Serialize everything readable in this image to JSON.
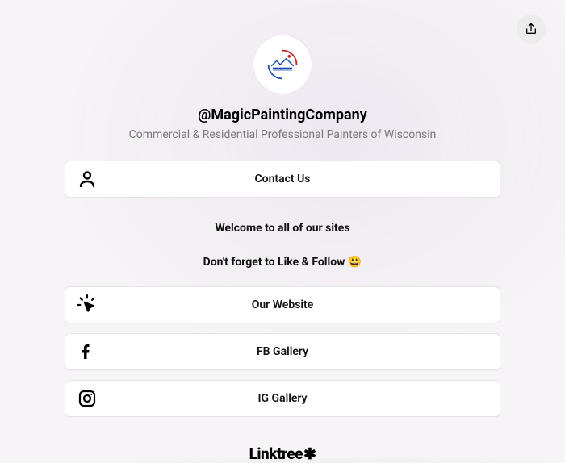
{
  "profile": {
    "handle": "@MagicPaintingCompany",
    "tagline": "Commercial & Residential Professional Painters of Wisconsin"
  },
  "headings": {
    "welcome": "Welcome to all of our sites",
    "cta": "Don't forget to Like & Follow 😃"
  },
  "links": {
    "contact": "Contact Us",
    "website": "Our Website",
    "fb": "FB Gallery",
    "ig": "IG Gallery"
  },
  "footer": {
    "brand": "Linktree"
  }
}
